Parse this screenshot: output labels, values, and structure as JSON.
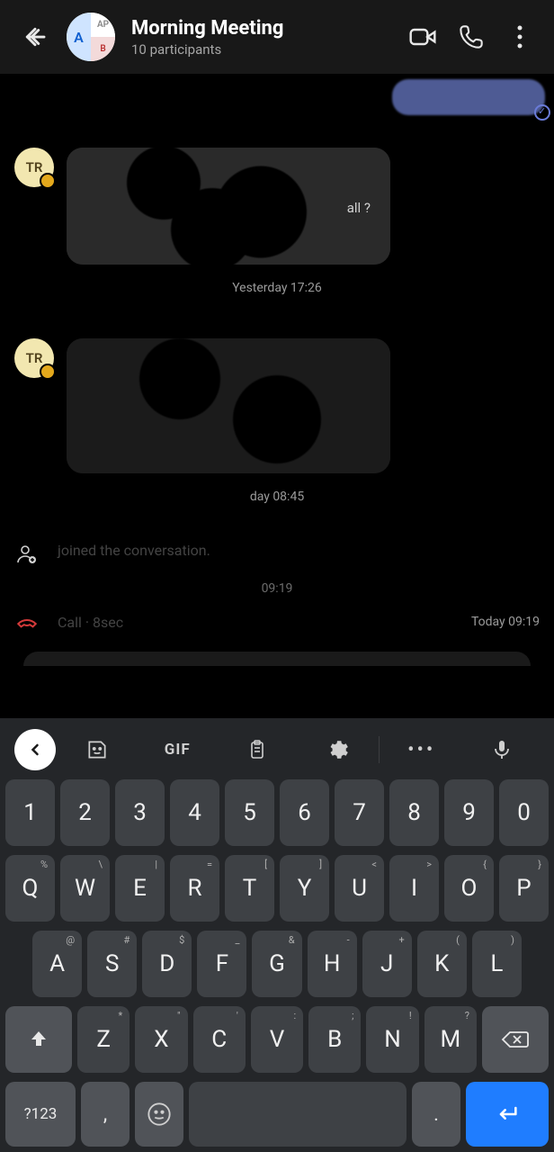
{
  "header": {
    "title": "Morning Meeting",
    "subtitle": "10 participants",
    "avatar": {
      "left": "A",
      "tr": "AP",
      "br": "B"
    }
  },
  "messages": {
    "avatar1_initials": "TR",
    "bubble1_fragment": "all ?",
    "sep1": "Yesterday 17:26",
    "avatar2_initials": "TR",
    "sep2": "day 08:45",
    "system_text": "joined the conversation.",
    "time_fragment": "09:19",
    "call_text": "Call · 8sec",
    "call_time": "Today 09:19"
  },
  "keyboard": {
    "gif": "GIF",
    "row1": [
      "1",
      "2",
      "3",
      "4",
      "5",
      "6",
      "7",
      "8",
      "9",
      "0"
    ],
    "row2": [
      {
        "k": "Q",
        "s": "%"
      },
      {
        "k": "W",
        "s": "\\"
      },
      {
        "k": "E",
        "s": "|"
      },
      {
        "k": "R",
        "s": "="
      },
      {
        "k": "T",
        "s": "["
      },
      {
        "k": "Y",
        "s": "]"
      },
      {
        "k": "U",
        "s": "<"
      },
      {
        "k": "I",
        "s": ">"
      },
      {
        "k": "O",
        "s": "{"
      },
      {
        "k": "P",
        "s": "}"
      }
    ],
    "row3": [
      {
        "k": "A",
        "s": "@"
      },
      {
        "k": "S",
        "s": "#"
      },
      {
        "k": "D",
        "s": "$"
      },
      {
        "k": "F",
        "s": "_"
      },
      {
        "k": "G",
        "s": "&"
      },
      {
        "k": "H",
        "s": "-"
      },
      {
        "k": "J",
        "s": "+"
      },
      {
        "k": "K",
        "s": "("
      },
      {
        "k": "L",
        "s": ")"
      }
    ],
    "row4": [
      {
        "k": "Z",
        "s": "*"
      },
      {
        "k": "X",
        "s": "\""
      },
      {
        "k": "C",
        "s": "'"
      },
      {
        "k": "V",
        "s": ":"
      },
      {
        "k": "B",
        "s": ";"
      },
      {
        "k": "N",
        "s": "!"
      },
      {
        "k": "M",
        "s": "?"
      }
    ],
    "symbols": "?123",
    "comma": ",",
    "period": "."
  }
}
